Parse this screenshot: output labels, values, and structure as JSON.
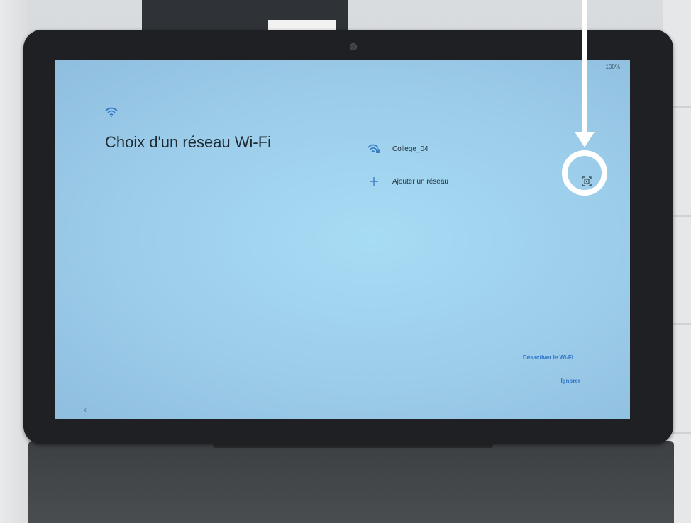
{
  "status_bar": {
    "battery": "100%"
  },
  "header": {
    "icon": "wifi-icon",
    "title": "Choix d'un réseau Wi-Fi"
  },
  "networks": [
    {
      "name": "College_04",
      "icon": "wifi-lock-icon"
    },
    {
      "name": "Ajouter un réseau",
      "icon": "plus-icon"
    }
  ],
  "qr_scan": {
    "icon": "qr-scan-icon"
  },
  "actions": {
    "disable_wifi": "Désactiver le Wi-Fi",
    "skip": "Ignorer"
  },
  "nav": {
    "back_icon": "back-chevron-icon",
    "back_glyph": "‹"
  },
  "colors": {
    "screen_bg": "#9fd3ee",
    "link": "#2d74c9",
    "text": "#1f2b33",
    "annotation": "#ffffff"
  }
}
